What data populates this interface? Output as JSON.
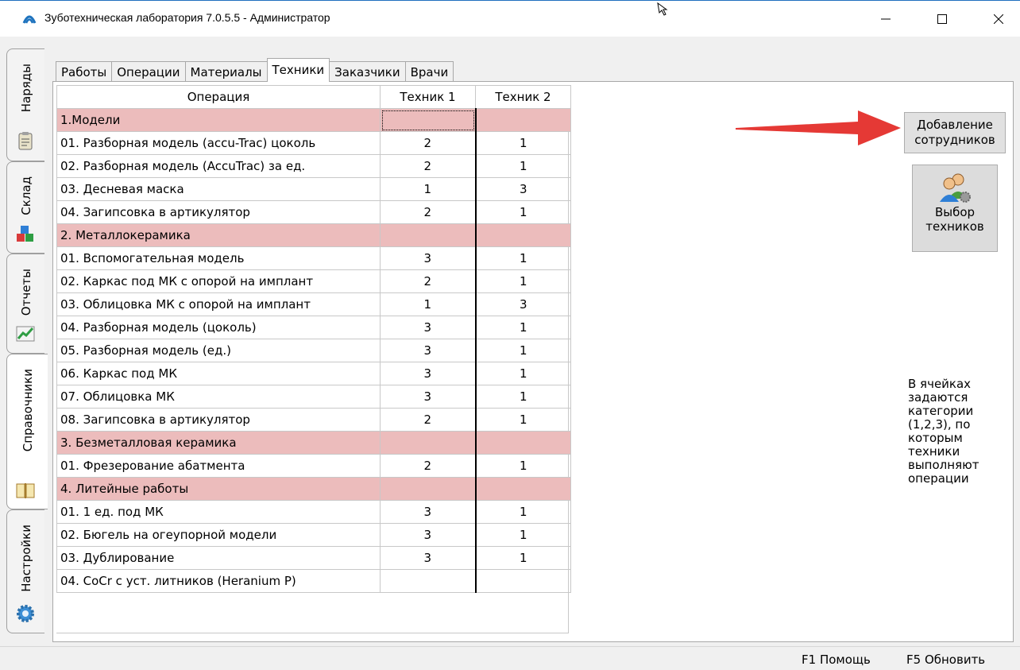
{
  "window": {
    "title": "Зуботехническая лаборатория 7.0.5.5 - Администратор",
    "controls": [
      "minimize",
      "maximize",
      "close"
    ]
  },
  "side_tabs": [
    {
      "label": "Наряды",
      "icon": "orders-icon"
    },
    {
      "label": "Склад",
      "icon": "warehouse-icon"
    },
    {
      "label": "Отчеты",
      "icon": "reports-icon"
    },
    {
      "label": "Справочники",
      "icon": "book-icon",
      "active": true
    },
    {
      "label": "Настройки",
      "icon": "gear-icon"
    }
  ],
  "tabs": [
    "Работы",
    "Операции",
    "Материалы",
    "Техники",
    "Заказчики",
    "Врачи"
  ],
  "active_tab": "Техники",
  "table": {
    "columns": [
      "Операция",
      "Техник 1",
      "Техник 2"
    ],
    "rows": [
      {
        "name": "1.Модели",
        "t1": "",
        "t2": "",
        "group": true
      },
      {
        "name": "01. Разборная модель (accu-Trac) цоколь",
        "t1": "2",
        "t2": "1"
      },
      {
        "name": "02. Разборная модель (AccuTrac) за ед.",
        "t1": "2",
        "t2": "1"
      },
      {
        "name": "03. Десневая маска",
        "t1": "1",
        "t2": "3"
      },
      {
        "name": "04. Загипсовка в артикулятор",
        "t1": "2",
        "t2": "1"
      },
      {
        "name": "2. Металлокерамика",
        "t1": "",
        "t2": "",
        "group": true
      },
      {
        "name": "01. Вспомогательная модель",
        "t1": "3",
        "t2": "1"
      },
      {
        "name": "02. Каркас под МК с опорой на имплант",
        "t1": "2",
        "t2": "1"
      },
      {
        "name": "03. Облицовка МК с опорой на имплант",
        "t1": "1",
        "t2": "3"
      },
      {
        "name": "04. Разборная модель (цоколь)",
        "t1": "3",
        "t2": "1"
      },
      {
        "name": "05. Разборная модель (ед.)",
        "t1": "3",
        "t2": "1"
      },
      {
        "name": "06. Каркас под МК",
        "t1": "3",
        "t2": "1"
      },
      {
        "name": "07. Облицовка МК",
        "t1": "3",
        "t2": "1"
      },
      {
        "name": "08. Загипсовка в артикулятор",
        "t1": "2",
        "t2": "1"
      },
      {
        "name": "3. Безметалловая керамика",
        "t1": "",
        "t2": "",
        "group": true
      },
      {
        "name": "01. Фрезерование абатмента",
        "t1": "2",
        "t2": "1"
      },
      {
        "name": "4. Литейные работы",
        "t1": "",
        "t2": "",
        "group": true
      },
      {
        "name": "01. 1 ед. под МК",
        "t1": "3",
        "t2": "1"
      },
      {
        "name": "02. Бюгель на огеупорной модели",
        "t1": "3",
        "t2": "1"
      },
      {
        "name": "03. Дублирование",
        "t1": "3",
        "t2": "1"
      },
      {
        "name": "04. CoCr с уст. литников (Heranium P)",
        "t1": "",
        "t2": ""
      }
    ]
  },
  "buttons": {
    "add_staff": [
      "Добавление",
      "сотрудников"
    ],
    "choose_techs": [
      "Выбор",
      "техников"
    ]
  },
  "note": [
    "В ячейках",
    "задаются",
    "категории",
    "(1,2,3), по",
    "которым",
    "техники",
    "выполняют",
    "операции"
  ],
  "status": {
    "help": "F1 Помощь",
    "refresh": "F5 Обновить"
  },
  "colors": {
    "group_row": "#ecbcbc",
    "annotation_arrow": "#e53935",
    "title_accent": "#1f6fbf"
  }
}
